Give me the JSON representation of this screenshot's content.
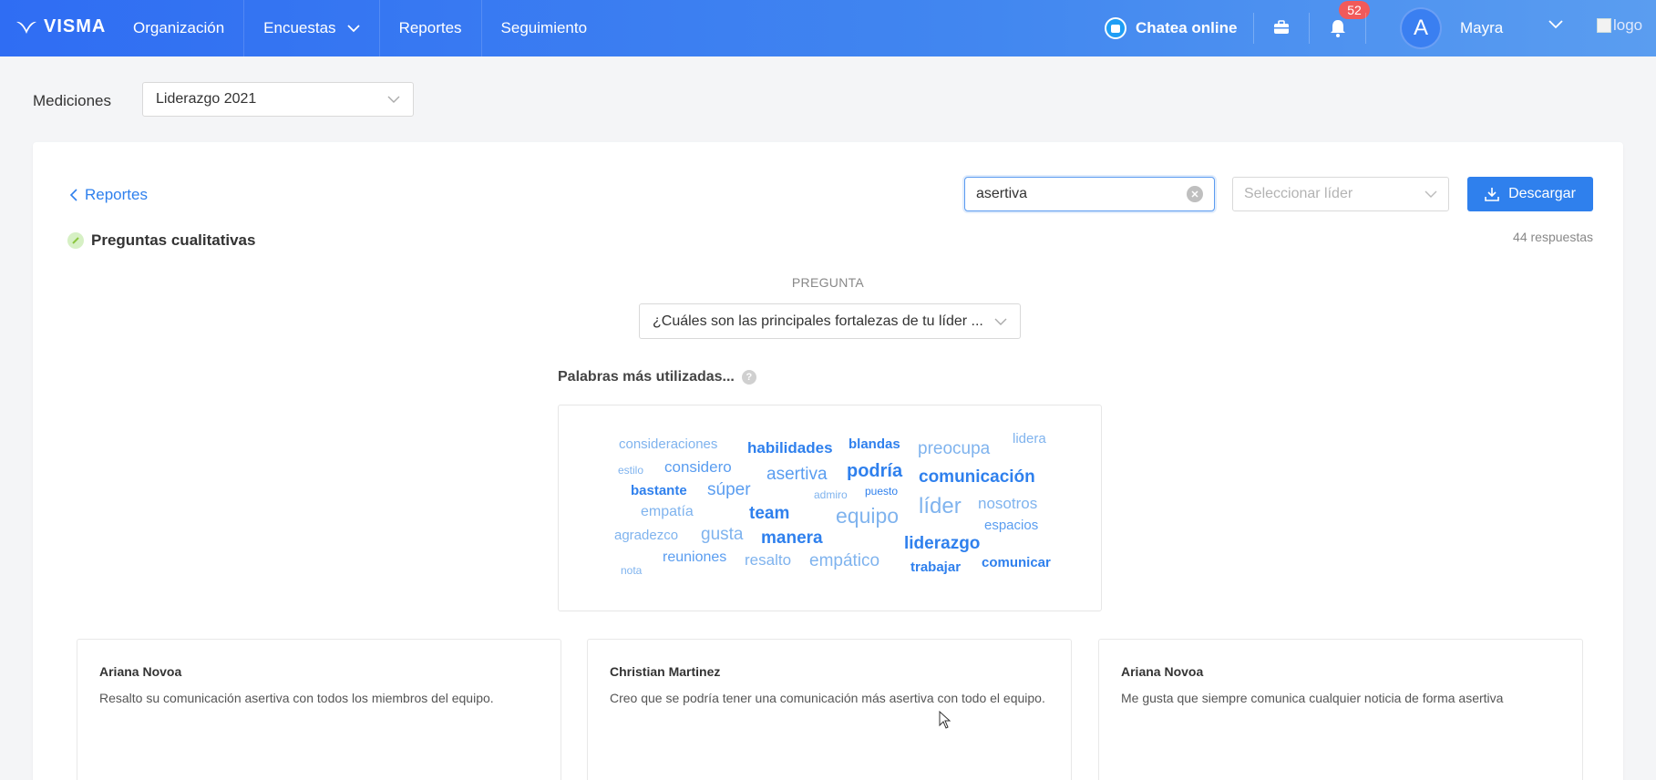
{
  "topbar": {
    "brand": "VISMA",
    "nav": [
      {
        "label": "Organización"
      },
      {
        "label": "Encuestas"
      },
      {
        "label": "Reportes"
      },
      {
        "label": "Seguimiento"
      }
    ],
    "chat_label": "Chatea online",
    "notification_count": "52",
    "avatar_initial": "A",
    "user_name": "Mayra",
    "logo_alt": "logo"
  },
  "filters": {
    "label": "Mediciones",
    "selected": "Liderazgo 2021"
  },
  "report": {
    "back_label": "Reportes",
    "search_value": "asertiva",
    "leader_placeholder": "Seleccionar líder",
    "download_label": "Descargar",
    "section_title": "Preguntas cualitativas",
    "response_count": "44 respuestas",
    "question_label": "PREGUNTA",
    "question_selected": "¿Cuáles son las principales fortalezas de tu líder ...",
    "cloud_title": "Palabras más utilizadas..."
  },
  "word_cloud": [
    {
      "text": "consideraciones",
      "color": "#7fb3ee"
    },
    {
      "text": "habilidades",
      "color": "#2f80ed"
    },
    {
      "text": "blandas",
      "color": "#2f80ed"
    },
    {
      "text": "preocupa",
      "color": "#7fb3ee"
    },
    {
      "text": "lidera",
      "color": "#7fb3ee"
    },
    {
      "text": "estilo",
      "color": "#7fb3ee"
    },
    {
      "text": "considero",
      "color": "#5a9df0"
    },
    {
      "text": "asertiva",
      "color": "#5a9df0"
    },
    {
      "text": "podría",
      "color": "#2f80ed"
    },
    {
      "text": "comunicación",
      "color": "#2f80ed"
    },
    {
      "text": "bastante",
      "color": "#2f80ed"
    },
    {
      "text": "súper",
      "color": "#5a9df0"
    },
    {
      "text": "admiro",
      "color": "#7fb3ee"
    },
    {
      "text": "puesto",
      "color": "#2f80ed"
    },
    {
      "text": "líder",
      "color": "#7fb3ee"
    },
    {
      "text": "nosotros",
      "color": "#7fb3ee"
    },
    {
      "text": "empatía",
      "color": "#7fb3ee"
    },
    {
      "text": "team",
      "color": "#2f80ed"
    },
    {
      "text": "equipo",
      "color": "#7fb3ee"
    },
    {
      "text": "espacios",
      "color": "#5a9df0"
    },
    {
      "text": "agradezco",
      "color": "#7fb3ee"
    },
    {
      "text": "gusta",
      "color": "#7fb3ee"
    },
    {
      "text": "manera",
      "color": "#2f80ed"
    },
    {
      "text": "liderazgo",
      "color": "#2f80ed"
    },
    {
      "text": "reuniones",
      "color": "#5a9df0"
    },
    {
      "text": "resalto",
      "color": "#7fb3ee"
    },
    {
      "text": "empático",
      "color": "#7fb3ee"
    },
    {
      "text": "comunicar",
      "color": "#2f80ed"
    },
    {
      "text": "nota",
      "color": "#7fb3ee"
    },
    {
      "text": "trabajar",
      "color": "#2f80ed"
    }
  ],
  "responses": [
    {
      "name": "Ariana Novoa",
      "text": "Resalto su comunicación asertiva con todos los miembros del equipo."
    },
    {
      "name": "Christian Martinez",
      "text": "Creo que se podría tener una comunicación más asertiva con todo el equipo."
    },
    {
      "name": "Ariana Novoa",
      "text": "Me gusta que siempre comunica cualquier noticia de forma asertiva"
    }
  ]
}
